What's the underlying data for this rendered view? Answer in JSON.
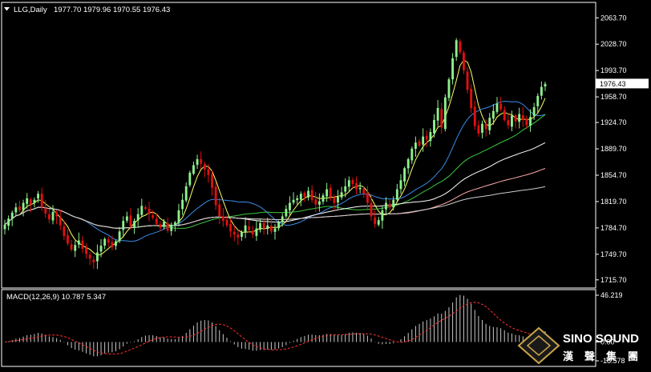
{
  "colors": {
    "background": "#000000",
    "up_candle": "#8ef08e",
    "down_candle": "#e01010",
    "ma5": "#ffff66",
    "ma20": "#3a8de8",
    "ma40": "#3ec83e",
    "ma60": "#ffffff",
    "ma100": "#ffaaaa",
    "ma200": "#cccccc",
    "macd_hist": "#c8c8c8",
    "macd_signal": "#ff3030",
    "axis": "#ffffff",
    "price_label_bg": "#ffffff"
  },
  "header": {
    "symbol_period": "LLG,Daily",
    "ohlc": "1977.70 1979.96 1970.55 1976.43"
  },
  "macd": {
    "label": "MACD(12,26,9) 10.787 5.347",
    "ticks": [
      "46.219",
      "0.00",
      "-18.578"
    ],
    "ylim": [
      -18.578,
      46.219
    ]
  },
  "watermark": {
    "brand": "SINO SOUND",
    "chinese": [
      "漢",
      "聲",
      "集",
      "團"
    ]
  },
  "chart_data": {
    "type": "candlestick",
    "title": "LLG,Daily",
    "ylim": [
      1707.0,
      2081.0
    ],
    "y_ticks": [
      "2063.70",
      "2028.70",
      "1993.70",
      "1958.70",
      "1924.70",
      "1889.70",
      "1854.70",
      "1819.70",
      "1784.70",
      "1749.70",
      "1715.70"
    ],
    "current_price": "1976.43",
    "closes": [
      1789,
      1797,
      1805,
      1812,
      1808,
      1818,
      1824,
      1816,
      1822,
      1830,
      1812,
      1804,
      1796,
      1806,
      1800,
      1788,
      1774,
      1764,
      1756,
      1762,
      1768,
      1757,
      1750,
      1744,
      1739,
      1752,
      1761,
      1770,
      1765,
      1759,
      1767,
      1780,
      1794,
      1800,
      1787,
      1794,
      1803,
      1814,
      1810,
      1803,
      1798,
      1790,
      1785,
      1793,
      1781,
      1789,
      1792,
      1808,
      1822,
      1840,
      1858,
      1868,
      1876,
      1870,
      1862,
      1855,
      1838,
      1815,
      1800,
      1794,
      1788,
      1780,
      1776,
      1772,
      1779,
      1788,
      1782,
      1776,
      1784,
      1791,
      1784,
      1788,
      1780,
      1784,
      1792,
      1800,
      1810,
      1818,
      1822,
      1824,
      1830,
      1826,
      1834,
      1822,
      1816,
      1820,
      1828,
      1836,
      1826,
      1818,
      1826,
      1832,
      1840,
      1848,
      1843,
      1836,
      1838,
      1830,
      1818,
      1800,
      1790,
      1795,
      1808,
      1818,
      1812,
      1822,
      1836,
      1848,
      1864,
      1876,
      1890,
      1898,
      1894,
      1906,
      1902,
      1912,
      1928,
      1944,
      1918,
      1958,
      1982,
      2010,
      2034,
      2018,
      1994,
      1968,
      1944,
      1920,
      1910,
      1923,
      1916,
      1931,
      1940,
      1950,
      1942,
      1928,
      1921,
      1934,
      1926,
      1936,
      1928,
      1921,
      1932,
      1945,
      1960,
      1972,
      1976
    ]
  }
}
